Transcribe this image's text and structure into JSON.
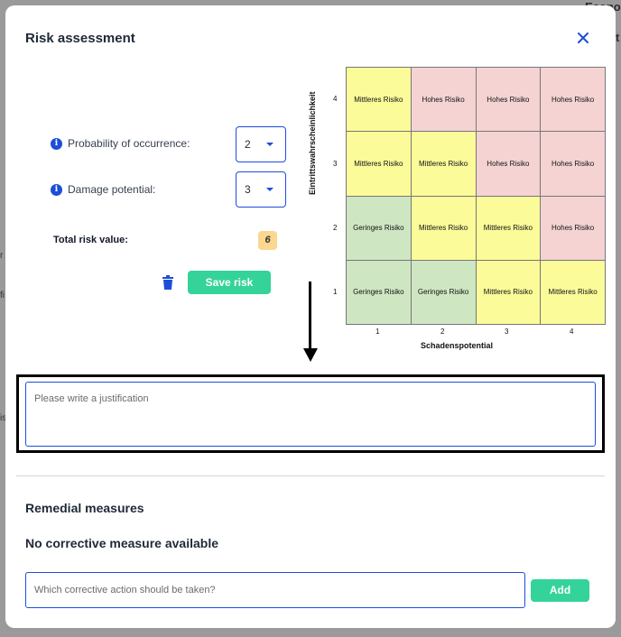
{
  "background": {
    "title_fragment": "Econo",
    "side_fragments": [
      "t",
      "r",
      "fi",
      "is"
    ]
  },
  "modal": {
    "title": "Risk assessment",
    "close_icon": "close-icon"
  },
  "form": {
    "probability_label": "Probability of occurrence:",
    "probability_value": "2",
    "damage_label": "Damage potential:",
    "damage_value": "3",
    "total_label": "Total risk value:",
    "total_value": "6",
    "save_label": "Save risk",
    "trash_icon": "trash-icon",
    "info_icon": "info-icon"
  },
  "matrix": {
    "ylabel": "Eintrittswahrscheinlichkeit",
    "xlabel": "Schadenspotential",
    "y_ticks": [
      "4",
      "3",
      "2",
      "1"
    ],
    "x_ticks": [
      "1",
      "2",
      "3",
      "4"
    ],
    "rows": [
      [
        "Mittleres Risiko",
        "Hohes Risiko",
        "Hohes Risiko",
        "Hohes Risiko"
      ],
      [
        "Mittleres Risiko",
        "Mittleres Risiko",
        "Hohes Risiko",
        "Hohes Risiko"
      ],
      [
        "Geringes Risiko",
        "Mittleres Risiko",
        "Mittleres Risiko",
        "Hohes Risiko"
      ],
      [
        "Geringes Risiko",
        "Geringes Risiko",
        "Mittleres Risiko",
        "Mittleres Risiko"
      ]
    ],
    "colors": {
      "mid": "#fbfb9a",
      "high": "#f5d3d3",
      "low": "#cfe6c2"
    }
  },
  "justification": {
    "placeholder": "Please write a justification"
  },
  "remedial": {
    "title": "Remedial measures",
    "empty_message": "No corrective measure available",
    "input_placeholder": "Which corrective action should be taken?",
    "add_label": "Add"
  }
}
